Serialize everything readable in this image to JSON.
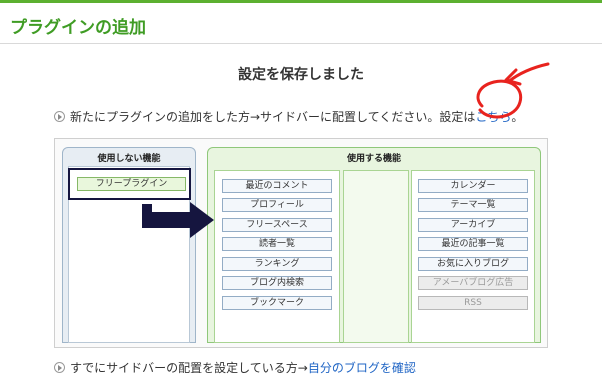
{
  "header": {
    "title": "プラグインの追加"
  },
  "message": {
    "saved": "設定を保存しました"
  },
  "instruction1": {
    "text": "新たにプラグインの追加をした方→サイドバーに配置してください。設定は",
    "link": "こちら",
    "suffix": "。"
  },
  "unused_panel": {
    "title": "使用しない機能",
    "items": [
      "フリープラグイン"
    ]
  },
  "used_panel": {
    "title": "使用する機能",
    "left_items": [
      "最近のコメント",
      "プロフィール",
      "フリースペース",
      "読者一覧",
      "ランキング",
      "ブログ内検索",
      "ブックマーク"
    ],
    "right_items": [
      "カレンダー",
      "テーマ一覧",
      "アーカイブ",
      "最近の記事一覧",
      "お気に入りブログ"
    ],
    "right_disabled": [
      "アメーバブログ広告",
      "RSS"
    ]
  },
  "instruction2": {
    "text": "すでにサイドバーの配置を設定している方→",
    "link": "自分のブログを確認"
  },
  "colors": {
    "accent_green": "#3f9c24",
    "link_blue": "#2166c5",
    "annotation_red": "#e8231e",
    "arrow_navy": "#15153f"
  }
}
